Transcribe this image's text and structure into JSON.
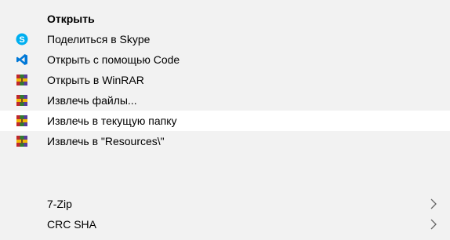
{
  "menu": {
    "items": [
      {
        "label": "Открыть",
        "icon": null,
        "bold": true
      },
      {
        "label": "Поделиться в Skype",
        "icon": "skype-icon"
      },
      {
        "label": "Открыть с помощью Code",
        "icon": "vscode-icon"
      },
      {
        "label": "Открыть в WinRAR",
        "icon": "winrar-icon"
      },
      {
        "label": "Извлечь файлы...",
        "icon": "winrar-icon"
      },
      {
        "label": "Извлечь в текущую папку",
        "icon": "winrar-icon",
        "hovered": true
      },
      {
        "label": "Извлечь в \"Resources\\\"",
        "icon": "winrar-icon"
      },
      {
        "label": "7-Zip",
        "icon": null,
        "submenu": true
      },
      {
        "label": "CRC SHA",
        "icon": null,
        "submenu": true
      }
    ]
  },
  "colors": {
    "menu_bg": "#f2f2f2",
    "hover_bg": "#ffffff",
    "skype_blue": "#00aff0",
    "vscode_blue": "#0078d7",
    "chevron": "#666666"
  }
}
